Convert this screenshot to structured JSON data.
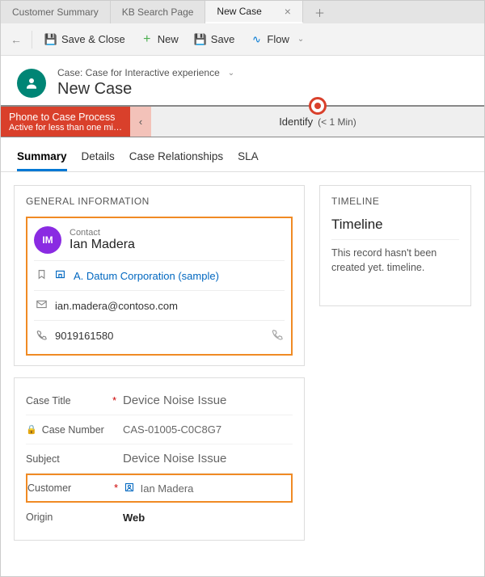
{
  "tabs": {
    "items": [
      {
        "label": "Customer Summary"
      },
      {
        "label": "KB Search Page"
      },
      {
        "label": "New Case"
      }
    ]
  },
  "commands": {
    "save_close": "Save & Close",
    "new": "New",
    "save": "Save",
    "flow": "Flow"
  },
  "case": {
    "breadcrumb": "Case: Case for Interactive experience",
    "title": "New Case"
  },
  "bpf": {
    "name": "Phone to Case Process",
    "duration_text": "Active for less than one mi…",
    "stage_label": "Identify",
    "stage_duration": "(< 1 Min)"
  },
  "sub_tabs": [
    "Summary",
    "Details",
    "Case Relationships",
    "SLA"
  ],
  "general": {
    "section_title": "GENERAL INFORMATION",
    "contact_label": "Contact",
    "contact_initials": "IM",
    "contact_name": "Ian Madera",
    "account": "A. Datum Corporation (sample)",
    "email": "ian.madera@contoso.com",
    "phone": "9019161580"
  },
  "form": {
    "case_title_label": "Case Title",
    "case_title_value": "Device Noise Issue",
    "case_number_label": "Case Number",
    "case_number_value": "CAS-01005-C0C8G7",
    "subject_label": "Subject",
    "subject_value": "Device Noise Issue",
    "customer_label": "Customer",
    "customer_value": "Ian Madera",
    "origin_label": "Origin",
    "origin_value": "Web"
  },
  "timeline": {
    "section_title": "TIMELINE",
    "header": "Timeline",
    "empty_text": "This record hasn't been created yet. timeline."
  }
}
